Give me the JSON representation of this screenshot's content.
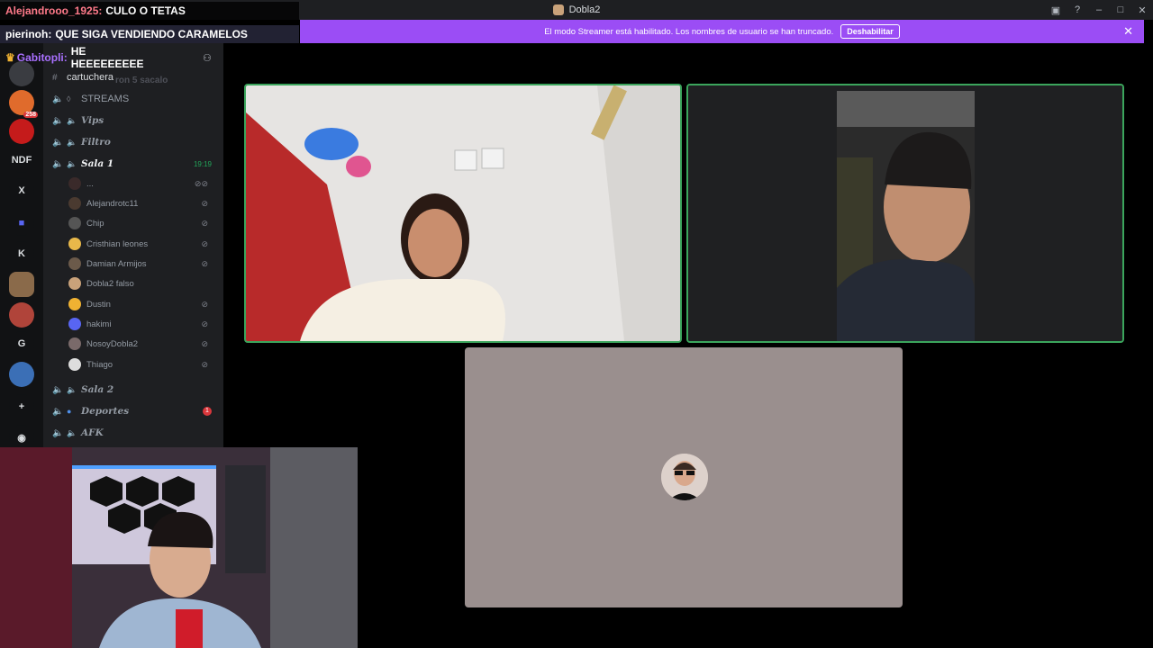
{
  "window": {
    "title": "Dobla2"
  },
  "banner": {
    "message": "El modo Streamer está habilitado. Los nombres de usuario se han truncado.",
    "button_label": "Deshabilitar",
    "color": "#9b4df5"
  },
  "chat_overlay": [
    {
      "user": "Alejandrooo_1925:",
      "message": "CULO O TETAS",
      "user_color": "#ff7a8a"
    },
    {
      "user": "pierinoh:",
      "message": "QUE SIGA VENDIENDO CARAMELOS",
      "user_color": "#ffffff"
    },
    {
      "user": "Gabitopli:",
      "message": "HE HEEEEEEEEE",
      "user_color": "#a970ff"
    }
  ],
  "channel_header": {
    "name": "cartuchera",
    "faded_text": "ron 5 sacalo"
  },
  "rail": {
    "items": [
      "NDF",
      "X",
      "K",
      "G"
    ],
    "badge_258": "258"
  },
  "channels": [
    {
      "name": "STREAMS",
      "type": "text"
    },
    {
      "name": "Vips",
      "type": "voice"
    },
    {
      "name": "Filtro",
      "type": "voice"
    },
    {
      "name": "Sala 1",
      "type": "voice",
      "active": true,
      "timer": "19:19"
    },
    {
      "name": "Sala 2",
      "type": "voice"
    },
    {
      "name": "Deportes",
      "type": "voice",
      "badge": "1"
    },
    {
      "name": "AFK",
      "type": "voice"
    }
  ],
  "members": [
    {
      "name": "..."
    },
    {
      "name": "Alejandrotc11"
    },
    {
      "name": "Chip"
    },
    {
      "name": "Cristhian leones"
    },
    {
      "name": "Damian Armijos"
    },
    {
      "name": "Dobla2 falso"
    },
    {
      "name": "Dustin"
    },
    {
      "name": "hakimi"
    },
    {
      "name": "NosoyDobla2"
    },
    {
      "name": "Thiago"
    }
  ],
  "colors": {
    "speaking": "#3ba55c",
    "voice_timer": "#23a55a",
    "badge": "#da373c"
  }
}
